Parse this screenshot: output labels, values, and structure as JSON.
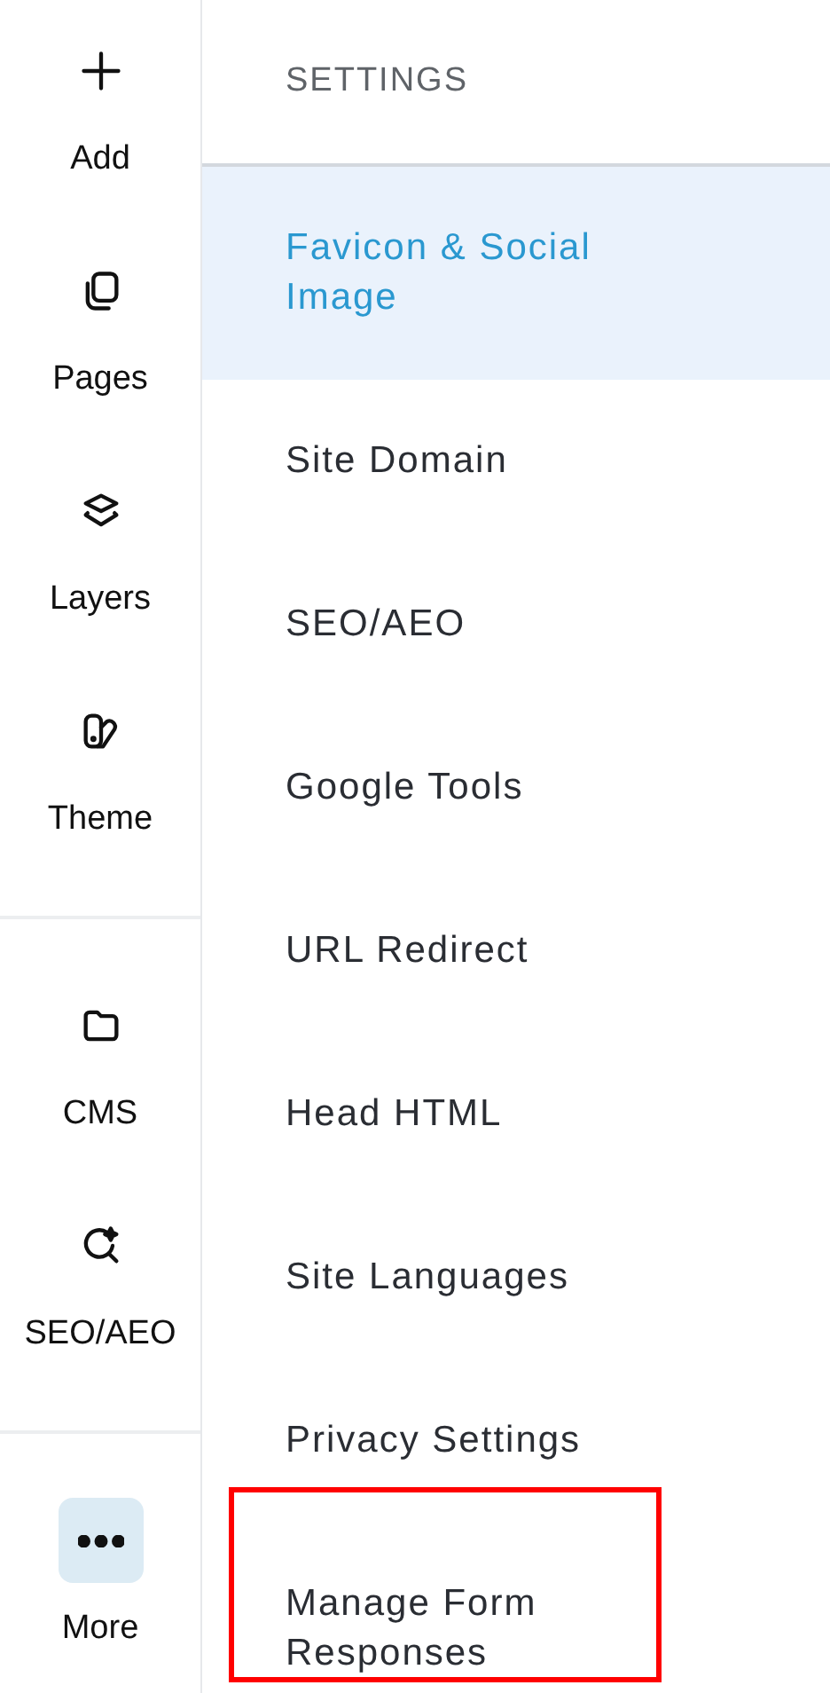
{
  "rail": {
    "groups": [
      {
        "items": [
          {
            "label": "Add",
            "selected": false
          },
          {
            "label": "Pages",
            "selected": false
          },
          {
            "label": "Layers",
            "selected": false
          },
          {
            "label": "Theme",
            "selected": false
          }
        ]
      },
      {
        "items": [
          {
            "label": "CMS",
            "selected": false
          },
          {
            "label": "SEO/AEO",
            "selected": false
          }
        ]
      },
      {
        "items": [
          {
            "label": "More",
            "selected": true
          }
        ]
      }
    ]
  },
  "settings": {
    "title": "SETTINGS",
    "items": [
      {
        "label": "Favicon & Social Image",
        "selected": true,
        "highlighted": false
      },
      {
        "label": "Site Domain",
        "selected": false,
        "highlighted": false
      },
      {
        "label": "SEO/AEO",
        "selected": false,
        "highlighted": false
      },
      {
        "label": "Google Tools",
        "selected": false,
        "highlighted": false
      },
      {
        "label": "URL Redirect",
        "selected": false,
        "highlighted": false
      },
      {
        "label": "Head HTML",
        "selected": false,
        "highlighted": false
      },
      {
        "label": "Site Languages",
        "selected": false,
        "highlighted": false
      },
      {
        "label": "Privacy Settings",
        "selected": false,
        "highlighted": false
      },
      {
        "label": "Manage Form Responses",
        "selected": false,
        "highlighted": true
      }
    ]
  }
}
